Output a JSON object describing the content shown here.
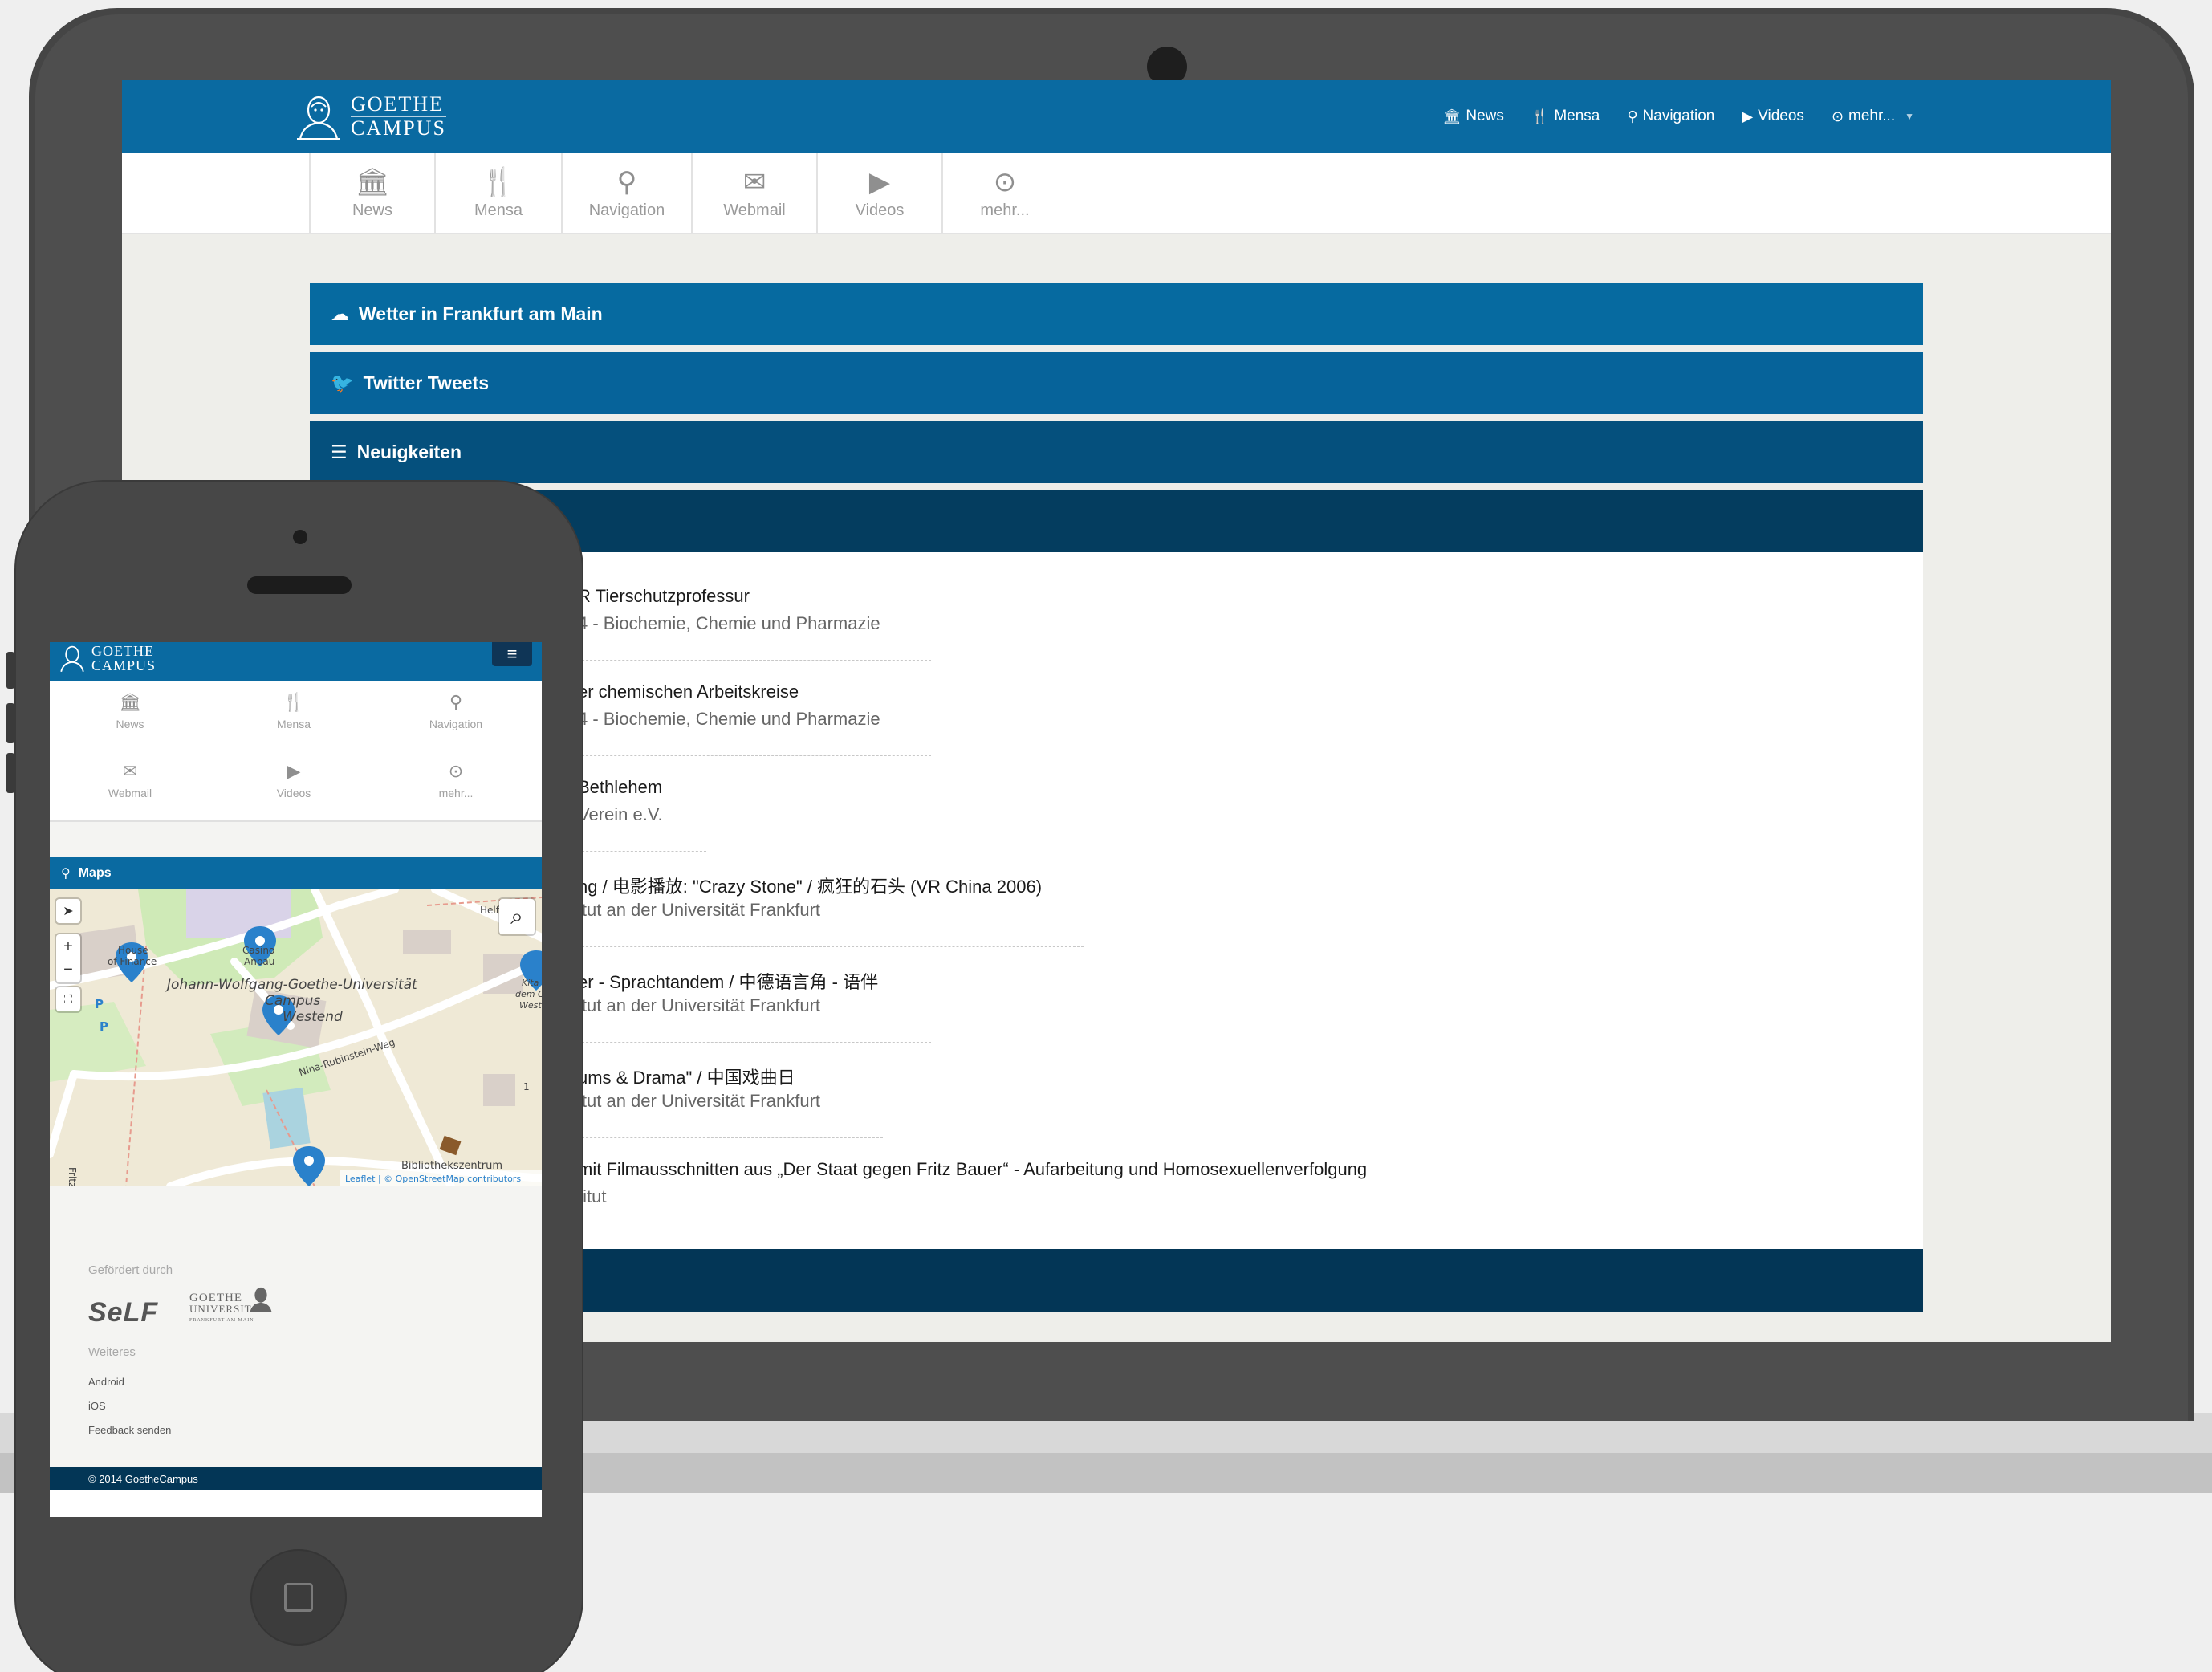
{
  "brand": {
    "line1": "GOETHE",
    "line2": "CAMPUS"
  },
  "topnav": {
    "items": [
      {
        "label": "News",
        "icon": "bank-icon"
      },
      {
        "label": "Mensa",
        "icon": "fork-knife-icon"
      },
      {
        "label": "Navigation",
        "icon": "map-marker-icon"
      },
      {
        "label": "Videos",
        "icon": "play-icon"
      },
      {
        "label": "mehr...",
        "icon": "circle-down-icon"
      }
    ]
  },
  "iconbar": {
    "items": [
      {
        "label": "News",
        "icon": "bank-icon"
      },
      {
        "label": "Mensa",
        "icon": "fork-knife-icon"
      },
      {
        "label": "Navigation",
        "icon": "map-marker-icon"
      },
      {
        "label": "Webmail",
        "icon": "envelope-icon"
      },
      {
        "label": "Videos",
        "icon": "play-icon"
      },
      {
        "label": "mehr...",
        "icon": "circle-down-icon"
      }
    ]
  },
  "panels": {
    "weather": "Wetter in Frankfurt am Main",
    "twitter": "Twitter Tweets",
    "news": "Neuigkeiten"
  },
  "news": [
    {
      "title": "R Tierschutzprofessur",
      "sub": "4 - Biochemie, Chemie und Pharmazie"
    },
    {
      "title": "er chemischen Arbeitskreise",
      "sub": "4 - Biochemie, Chemie und Pharmazie"
    },
    {
      "title": "Bethlehem",
      "sub": "Verein e.V."
    },
    {
      "title": "ng / 电影播放: \"Crazy Stone\" / 疯狂的石头 (VR China 2006)",
      "sub": "itut an der Universität Frankfurt"
    },
    {
      "title": "er - Sprachtandem / 中德语言角 - 语伴",
      "sub": "itut an der Universität Frankfurt"
    },
    {
      "title": "ums & Drama\" / 中国戏曲日",
      "sub": "itut an der Universität Frankfurt"
    },
    {
      "title": "mit Filmausschnitten aus „Der Staat gegen Fritz Bauer“ - Aufarbeitung und Homosexuellenverfolgung",
      "sub": "titut"
    }
  ],
  "phone": {
    "brand_line1": "GOETHE",
    "brand_line2": "CAMPUS",
    "icons": [
      {
        "label": "News"
      },
      {
        "label": "Mensa"
      },
      {
        "label": "Navigation"
      },
      {
        "label": "Webmail"
      },
      {
        "label": "Videos"
      },
      {
        "label": "mehr..."
      }
    ],
    "maps_title": "Maps",
    "map_labels": {
      "house_of_finance_1": "House",
      "house_of_finance_2": "of Finance",
      "casino_1": "Casino",
      "casino_2": "Anbau",
      "campus_1": "Johann-Wolfgang-Goethe-Universität",
      "campus_2": "Campus",
      "campus_3": "Westend",
      "street_1": "Nina-Rubinstein-Weg",
      "street_2": "Fritz-N",
      "library": "Bibliothekszentrum",
      "helf": "Helf",
      "attribution": "Leaflet | © OpenStreetMap contributors",
      "kita_1": "Kita",
      "kita_2": "dem Ca",
      "kita_3": "West",
      "one": "1"
    },
    "footer": {
      "funded_by": "Gefördert durch",
      "self_logo": "SeLF",
      "goethe_logo_1": "GOETHE",
      "goethe_logo_2": "UNIVERSITÄT",
      "goethe_logo_3": "FRANKFURT AM MAIN",
      "more": "Weiteres",
      "links": [
        "Android",
        "iOS",
        "Feedback senden"
      ],
      "copyright": "© 2014 GoetheCampus"
    }
  },
  "colors": {
    "primary": "#0a6aa1",
    "dark": "#033656",
    "marker": "#2a81cb"
  }
}
